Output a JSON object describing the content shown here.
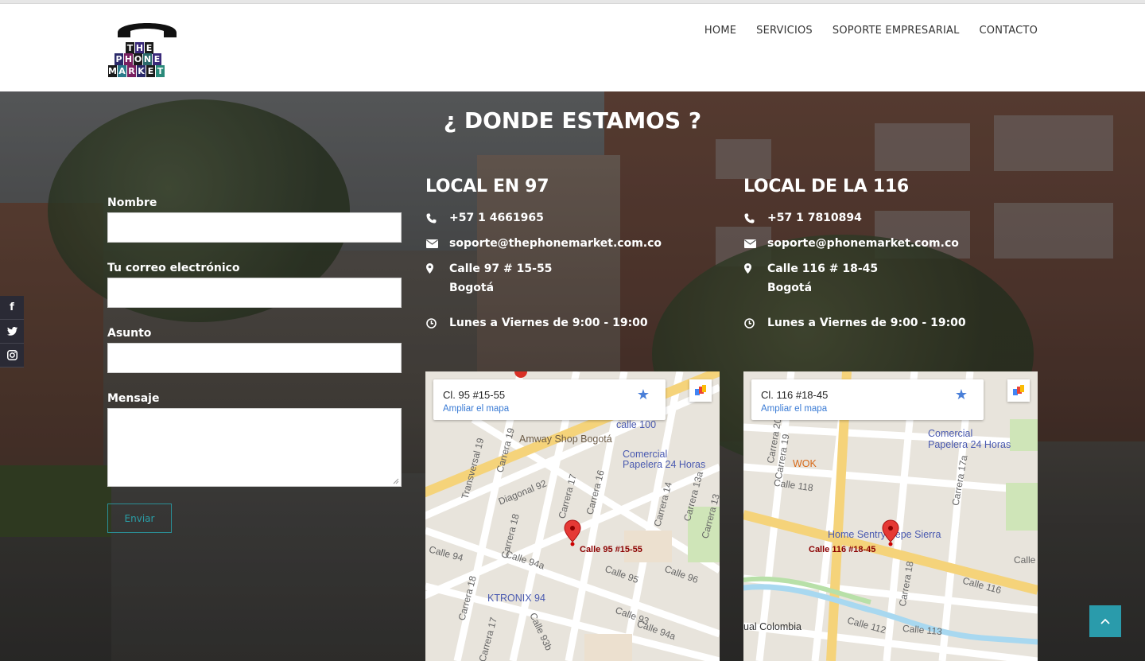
{
  "header": {
    "logo_words": [
      "THE",
      "PHONE",
      "MARKET"
    ],
    "nav": [
      "HOME",
      "SERVICIOS",
      "SOPORTE EMPRESARIAL",
      "CONTACTO"
    ]
  },
  "title": "¿ DONDE ESTAMOS ?",
  "form": {
    "labels": [
      "Nombre",
      "Tu correo electrónico",
      "Asunto",
      "Mensaje"
    ],
    "submit": "Enviar"
  },
  "social": [
    "facebook-icon",
    "twitter-icon",
    "instagram-icon"
  ],
  "locations": [
    {
      "name": "LOCAL EN 97",
      "phone": "+57 1 4661965",
      "email": "soporte@thephonemarket.com.co",
      "address": "Calle 97 # 15-55",
      "city": "Bogotá",
      "hours": "Lunes a Viernes de 9:00 - 19:00",
      "map": {
        "card_address": "Cl. 95 #15-55",
        "card_link": "Ampliar el mapa",
        "pin_label": "Calle 95 #15-55",
        "pois": [
          "Amway Shop Bogotá",
          "Comercial",
          "Papelera 24 Horas",
          "KTRONIX 94",
          "calle 100"
        ],
        "streets": [
          "Transversal 19",
          "Carrera 19",
          "Diagonal 92",
          "Carrera 18",
          "Carrera 17",
          "Carrera 16",
          "Carrera 14",
          "Carrera 13a",
          "Carrera 13",
          "Calle 94",
          "Calle 94a",
          "Calle 95",
          "Calle 96",
          "Carrera 18",
          "Carrera 17",
          "Calle 93b",
          "Calle 94a",
          "Calle 93"
        ]
      }
    },
    {
      "name": "LOCAL DE LA 116",
      "phone": "+57 1 7810894",
      "email": "soporte@phonemarket.com.co",
      "address": "Calle 116 # 18-45",
      "city": "Bogotá",
      "hours": "Lunes a Viernes de 9:00 - 19:00",
      "map": {
        "card_address": "Cl. 116 #18-45",
        "card_link": "Ampliar el mapa",
        "pin_label": "Calle 116 #18-45",
        "pois": [
          "Comercial",
          "Papelera 24 Horas",
          "WOK",
          "Home Sentry Pepe Sierra",
          "ual Colombia"
        ],
        "streets": [
          "Carrera 20",
          "Carrera 19",
          "Calle 118",
          "Carrera 17a",
          "Calle 116",
          "Calle 112",
          "Calle 113",
          "Carrera 18",
          "Calle"
        ]
      }
    }
  ],
  "colors": {
    "accent": "#2a9bab",
    "nav_text": "#333333",
    "map_link": "#3a7bd5",
    "pin": "#d93025"
  }
}
